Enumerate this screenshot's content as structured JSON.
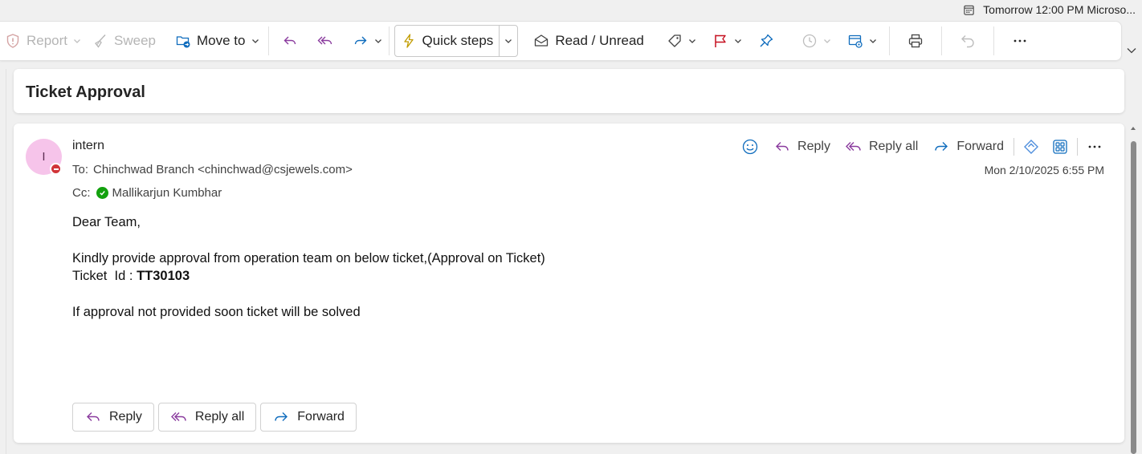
{
  "reminder": {
    "icon": "calendar-icon",
    "text": "Tomorrow 12:00 PM Microso..."
  },
  "toolbar": {
    "report": "Report",
    "sweep": "Sweep",
    "move_to": "Move to",
    "quick_steps": "Quick steps",
    "read_unread": "Read / Unread"
  },
  "message": {
    "subject": "Ticket Approval",
    "avatar_initial": "I",
    "sender": "intern",
    "to_label": "To:",
    "to_value": "Chinchwad Branch <chinchwad@csjewels.com>",
    "cc_label": "Cc:",
    "cc_value": "Mallikarjun Kumbhar",
    "date": "Mon 2/10/2025 6:55 PM",
    "actions": {
      "reply": "Reply",
      "reply_all": "Reply all",
      "forward": "Forward"
    },
    "body": {
      "greeting": "Dear Team,",
      "line1": "Kindly provide approval from operation team on below ticket,(Approval on Ticket)",
      "ticket_label": "Ticket  Id : ",
      "ticket_id": "TT30103",
      "line3": "If approval not provided soon ticket will be solved"
    }
  },
  "bottom_actions": {
    "reply": "Reply",
    "reply_all": "Reply all",
    "forward": "Forward"
  },
  "colors": {
    "accent": "#0f6cbd",
    "reply_purple": "#8a3b9e",
    "flag_red": "#c50f1f",
    "avatar_bg": "#f6c4ea",
    "presence_busy": "#d13438",
    "presence_ok": "#13a10e"
  }
}
